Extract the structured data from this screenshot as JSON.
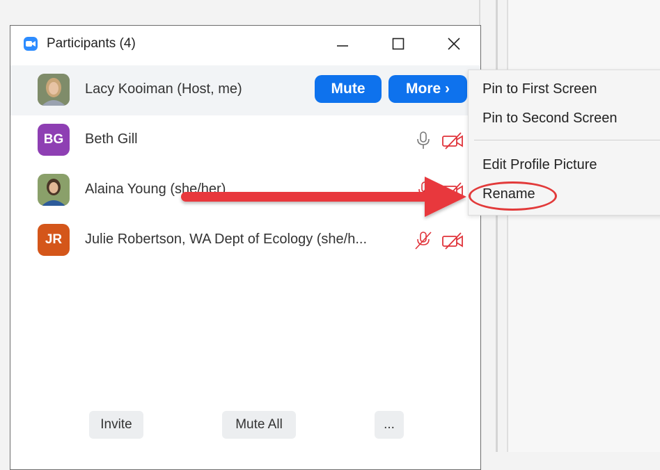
{
  "window": {
    "title": "Participants (4)"
  },
  "participants": [
    {
      "name": "Lacy Kooiman (Host, me)",
      "avatar": "photo"
    },
    {
      "name": "Beth Gill",
      "initials": "BG",
      "avatar_color": "#8e3fb3"
    },
    {
      "name": "Alaina Young (she/her)",
      "avatar": "photo"
    },
    {
      "name": "Julie Robertson, WA Dept of Ecology (she/h...",
      "initials": "JR",
      "avatar_color": "#d4561a"
    }
  ],
  "host_actions": {
    "mute_label": "Mute",
    "more_label": "More ›"
  },
  "footer": {
    "invite_label": "Invite",
    "mute_all_label": "Mute All",
    "more_label": "..."
  },
  "context_menu": {
    "items": [
      "Pin to First Screen",
      "Pin to Second Screen",
      "Edit Profile Picture",
      "Rename"
    ]
  },
  "colors": {
    "accent_blue": "#0e72ed",
    "muted_red": "#e0333a",
    "annotation_red": "#e23a3a"
  },
  "icons": [
    "zoom-app-icon",
    "minimize-icon",
    "maximize-icon",
    "close-icon",
    "microphone-icon",
    "microphone-muted-icon",
    "video-off-icon",
    "arrow-annotation"
  ]
}
